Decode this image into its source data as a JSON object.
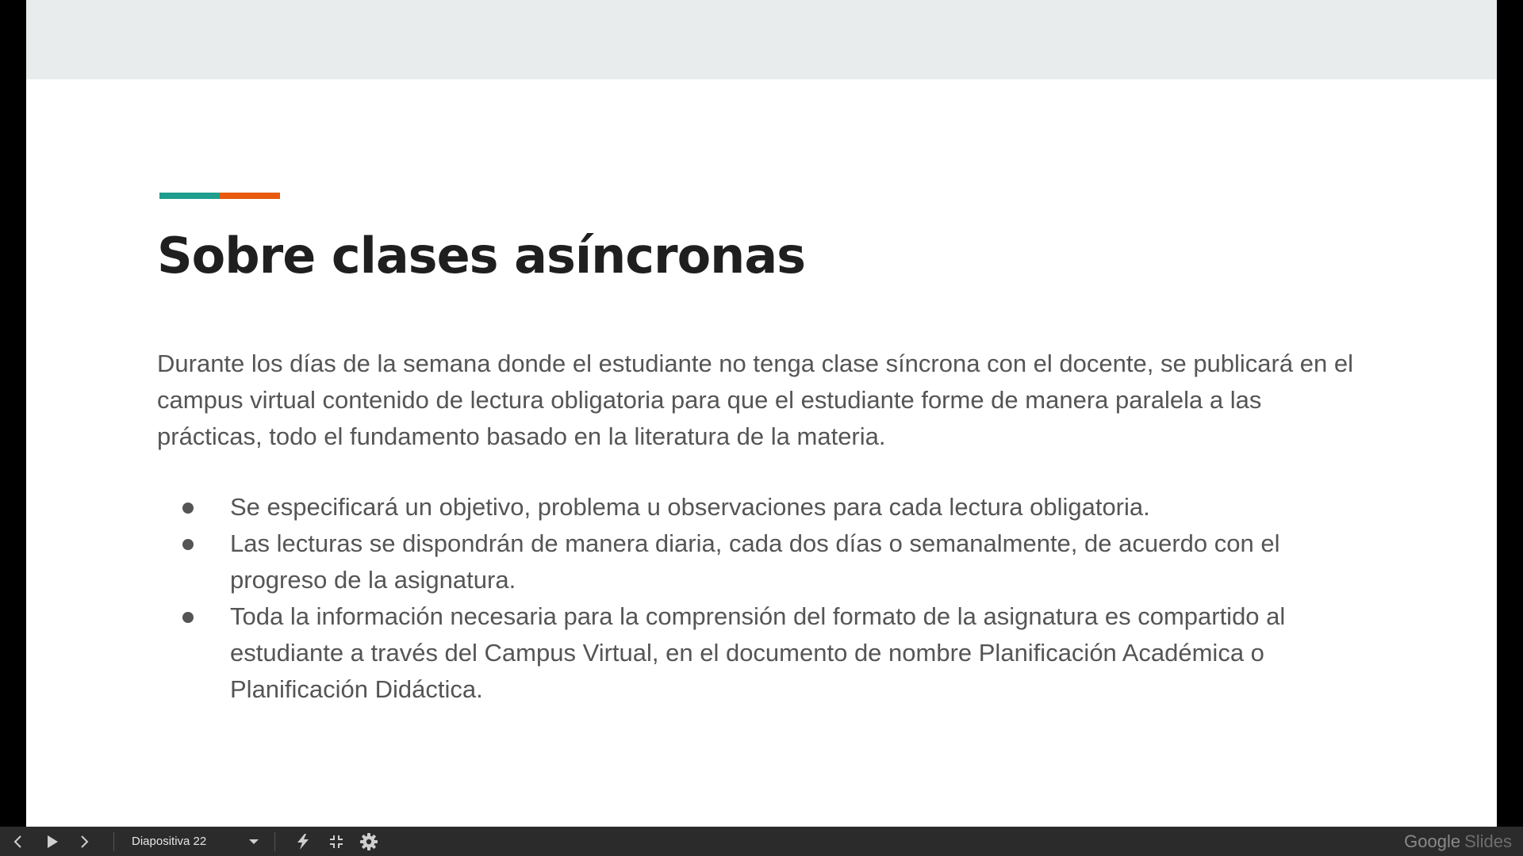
{
  "slide": {
    "title": "Sobre clases asíncronas",
    "paragraph": "Durante los días de la semana donde el estudiante no tenga clase síncrona con el docente, se publicará en el campus virtual contenido de lectura obligatoria para que el estudiante forme de manera paralela a las prácticas, todo el fundamento basado en la literatura de la materia.",
    "bullets": [
      {
        "text": "Se especificará un objetivo, problema u observaciones para cada lectura obligatoria."
      },
      {
        "text": "Las lecturas se dispondrán de manera diaria, cada dos días o semanalmente, de acuerdo con el progreso de la asignatura."
      },
      {
        "text": "Toda la información necesaria para la comprensión del formato de la asignatura es compartido al estudiante a través del Campus Virtual, en el documento de nombre Planificación Académica o Planificación Didáctica."
      }
    ],
    "accent_colors": {
      "teal": "#1f9e8e",
      "orange": "#e8590c"
    },
    "header_band_color": "#e8ecec"
  },
  "toolbar": {
    "buttons": {
      "previous": "chevron-left-icon",
      "play": "play-icon",
      "next": "chevron-right-icon",
      "laser": "laser-pointer-icon",
      "exit_fullscreen": "exit-fullscreen-icon",
      "settings": "gear-icon"
    },
    "slide_selector_label": "Diapositiva 22",
    "brand_name": "Google",
    "brand_product": "Slides"
  }
}
